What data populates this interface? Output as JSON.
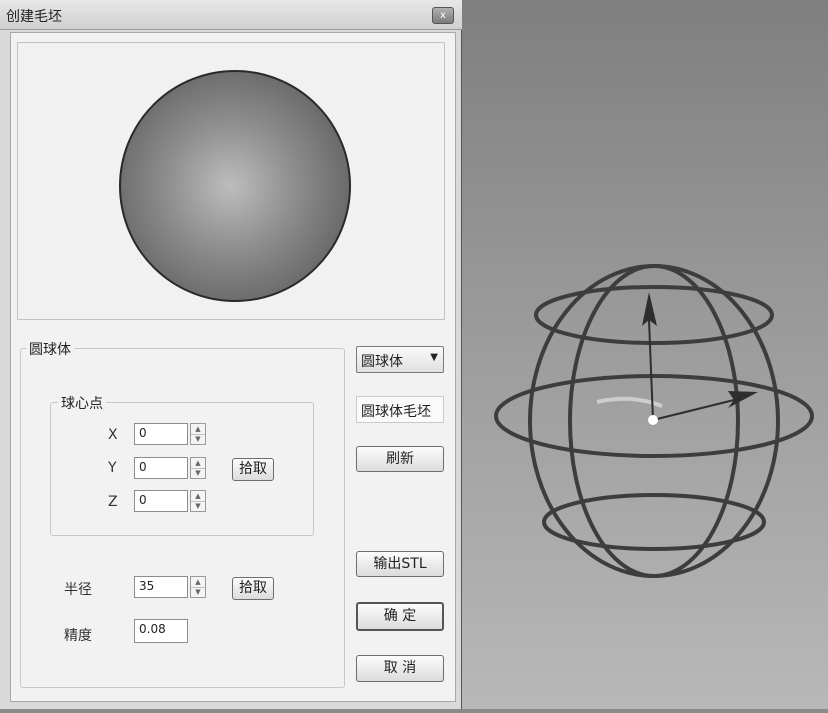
{
  "window": {
    "title": "创建毛坯",
    "close_glyph": "x"
  },
  "group": {
    "label": "圆球体",
    "center_label": "球心点",
    "x_label": "X",
    "y_label": "Y",
    "z_label": "Z",
    "x_value": "0",
    "y_value": "0",
    "z_value": "0",
    "pick_center_label": "拾取",
    "radius_label": "半径",
    "radius_value": "35",
    "pick_radius_label": "拾取",
    "precision_label": "精度",
    "precision_value": "0.08"
  },
  "side": {
    "shape_selected": "圆球体",
    "blank_name": "圆球体毛坯",
    "refresh_label": "刷新",
    "export_label": "输出STL",
    "ok_label": "确 定",
    "cancel_label": "取 消"
  },
  "colors": {
    "sphere_mid": "#8f8f8f",
    "sphere_edge": "#5a5a5a",
    "wire": "#3d3d3d",
    "axis": "#2e2e2e"
  }
}
